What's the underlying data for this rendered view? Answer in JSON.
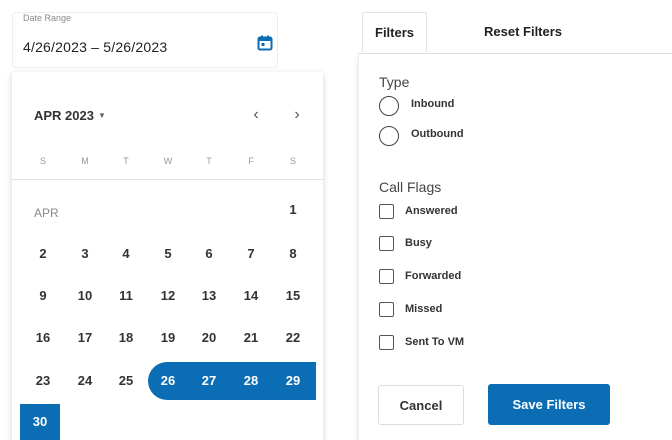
{
  "date_range": {
    "label": "Date Range",
    "value": "4/26/2023 – 5/26/2023",
    "icon": "calendar-icon"
  },
  "calendar": {
    "month_year": "APR 2023",
    "prev_icon": "chevron-left-icon",
    "next_icon": "chevron-right-icon",
    "weekdays": [
      "S",
      "M",
      "T",
      "W",
      "T",
      "F",
      "S"
    ],
    "month_label": "APR",
    "days": [
      "1",
      "2",
      "3",
      "4",
      "5",
      "6",
      "7",
      "8",
      "9",
      "10",
      "11",
      "12",
      "13",
      "14",
      "15",
      "16",
      "17",
      "18",
      "19",
      "20",
      "21",
      "22",
      "23",
      "24",
      "25",
      "26",
      "27",
      "28",
      "29",
      "30"
    ],
    "selected_range": {
      "start": "26",
      "end": "30"
    },
    "accent_color": "#0b6eb5"
  },
  "tabs": {
    "filters": "Filters",
    "reset": "Reset Filters"
  },
  "filters": {
    "type_title": "Type",
    "type_options": [
      "Inbound",
      "Outbound"
    ],
    "flags_title": "Call Flags",
    "flag_options": [
      "Answered",
      "Busy",
      "Forwarded",
      "Missed",
      "Sent To VM"
    ]
  },
  "buttons": {
    "cancel": "Cancel",
    "save": "Save Filters"
  }
}
